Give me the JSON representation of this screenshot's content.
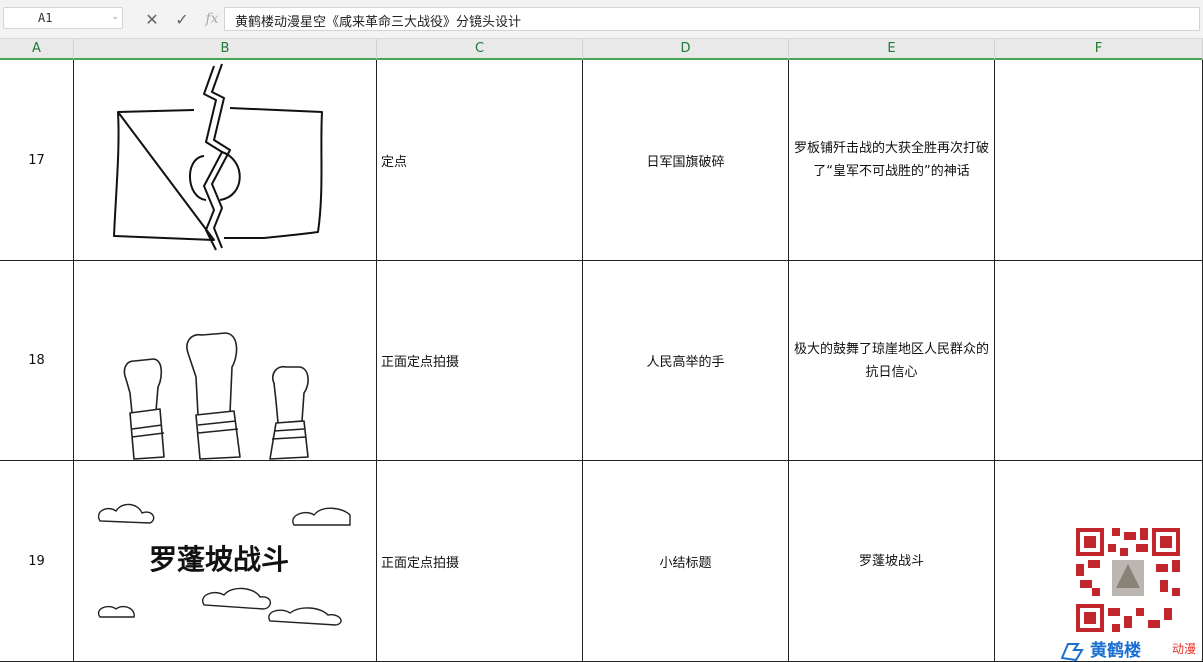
{
  "formula_bar": {
    "name_box": "A1",
    "fx_label": "fx",
    "formula_text": "黄鹤楼动漫星空《咸来革命三大战役》分镜头设计"
  },
  "columns": [
    "A",
    "B",
    "C",
    "D",
    "E",
    "F"
  ],
  "rows": [
    {
      "num": "17",
      "shot": "定点",
      "content": "日军国旗破碎",
      "description": "罗板铺歼击战的大获全胜再次打破了“皇军不可战胜的”的神话"
    },
    {
      "num": "18",
      "shot": "正面定点拍摄",
      "content": "人民高举的手",
      "description": "极大的鼓舞了琼崖地区人民群众的抗日信心"
    },
    {
      "num": "19",
      "shot": "正面定点拍摄",
      "content": "小结标题",
      "description": "罗蓬坡战斗"
    }
  ],
  "sketch_title": "罗蓬坡战斗",
  "logo": {
    "cn": "黄鹤楼",
    "suffix": "动漫"
  },
  "colors": {
    "header_text": "#1e7a34",
    "header_line": "#4aa554",
    "logo_blue": "#1c6fd1",
    "logo_red": "#e6332a"
  }
}
